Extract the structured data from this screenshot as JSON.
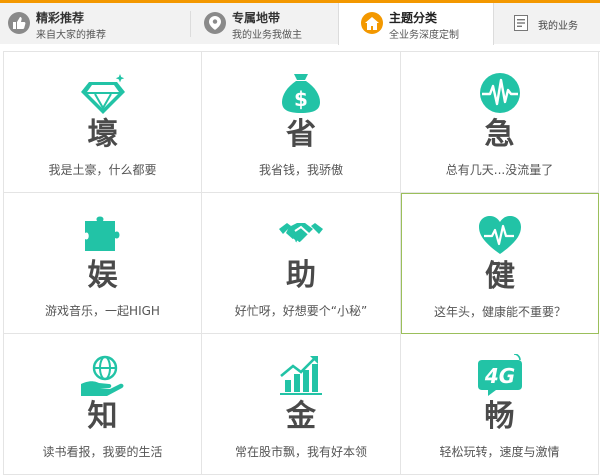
{
  "tabs": [
    {
      "title": "精彩推荐",
      "subtitle": "来自大家的推荐",
      "icon": "thumbs-up-icon"
    },
    {
      "title": "专属地带",
      "subtitle": "我的业务我做主",
      "icon": "location-pin-icon"
    },
    {
      "title": "主题分类",
      "subtitle": "全业务深度定制",
      "icon": "home-icon",
      "active": true
    },
    {
      "title": "我的业务",
      "icon": "document-icon"
    }
  ],
  "cells": [
    {
      "char": "壕",
      "desc": "我是土豪，什么都要",
      "icon": "diamond-icon"
    },
    {
      "char": "省",
      "desc": "我省钱，我骄傲",
      "icon": "money-bag-icon"
    },
    {
      "char": "急",
      "desc": "总有几天...没流量了",
      "icon": "pulse-icon"
    },
    {
      "char": "娱",
      "desc": "游戏音乐，一起HIGH",
      "icon": "puzzle-icon"
    },
    {
      "char": "助",
      "desc": "好忙呀，好想要个“小秘”",
      "icon": "handshake-icon"
    },
    {
      "char": "健",
      "desc": "这年头，健康能不重要？",
      "icon": "heart-health-icon",
      "highlighted": true
    },
    {
      "char": "知",
      "desc": "读书看报，我要的生活",
      "icon": "globe-hand-icon"
    },
    {
      "char": "金",
      "desc": "常在股市飘，我有好本领",
      "icon": "growth-chart-icon"
    },
    {
      "char": "畅",
      "desc": "轻松玩转，速度与激情",
      "icon": "4g-icon"
    }
  ],
  "colors": {
    "accent": "#f39800",
    "icon_teal": "#22c3a6",
    "highlight_border": "#9bbf5b"
  }
}
